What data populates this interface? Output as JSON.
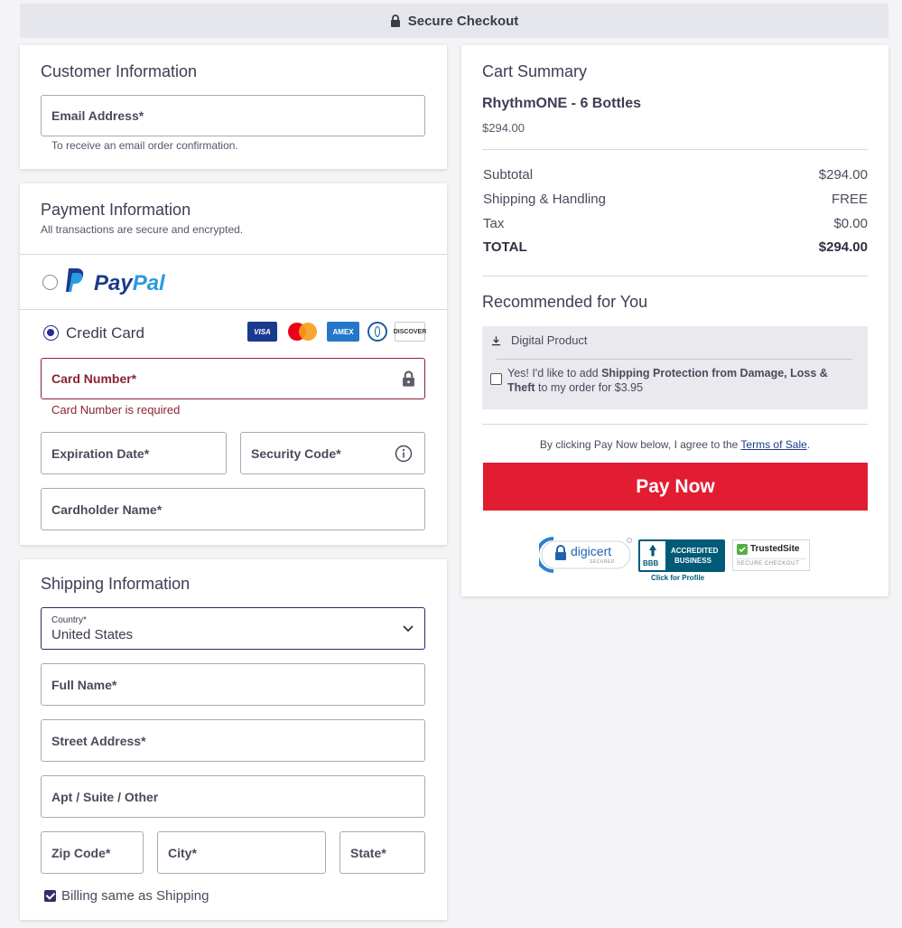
{
  "header": {
    "title": "Secure Checkout"
  },
  "customer": {
    "title": "Customer Information",
    "email_label": "Email Address*",
    "email_hint": "To receive an email order confirmation."
  },
  "payment": {
    "title": "Payment Information",
    "subtitle": "All transactions are secure and encrypted.",
    "paypal_pay": "Pay",
    "paypal_pal": "Pal",
    "credit_label": "Credit Card",
    "card_brands": [
      "VISA",
      "Mastercard",
      "AMEX",
      "Diners Club",
      "DISCOVER"
    ],
    "card_number_label": "Card Number*",
    "card_number_error": "Card Number is required",
    "expiration_label": "Expiration Date*",
    "security_label": "Security Code*",
    "cardholder_label": "Cardholder Name*"
  },
  "shipping": {
    "title": "Shipping Information",
    "country_label": "Country*",
    "country_value": "United States",
    "full_name_label": "Full Name*",
    "street_label": "Street Address*",
    "apt_label": "Apt / Suite / Other",
    "zip_label": "Zip Code*",
    "city_label": "City*",
    "state_label": "State*",
    "billing_same": "Billing same as Shipping"
  },
  "cart": {
    "title": "Cart Summary",
    "product_name": "RhythmONE - 6 Bottles",
    "product_price": "$294.00",
    "rows": [
      {
        "label": "Subtotal",
        "value": "$294.00"
      },
      {
        "label": "Shipping & Handling",
        "value": "FREE"
      },
      {
        "label": "Tax",
        "value": "$0.00"
      }
    ],
    "total_label": "TOTAL",
    "total_value": "$294.00"
  },
  "recommended": {
    "title": "Recommended for You",
    "digital_label": "Digital Product",
    "offer_pre": "Yes! I'd like to add ",
    "offer_bold1": "Shipping Protection from Damage, Loss &",
    "offer_bold2": "Theft",
    "offer_post": " to my order for $3.95"
  },
  "agreement": {
    "pre": "By clicking Pay Now below, I agree to the ",
    "link": "Terms of Sale",
    "post": "."
  },
  "pay_button": "Pay Now",
  "badges": {
    "digicert": "digicert",
    "digicert_sub": "SECURED",
    "bbb_line1": "ACCREDITED",
    "bbb_line2": "BUSINESS",
    "bbb_logo": "BBB",
    "bbb_caption": "Click for Profile",
    "trusted_name": "TrustedSite",
    "trusted_sub": "SECURE CHECKOUT"
  },
  "colors": {
    "accent": "#e21d31",
    "error": "#8a2333",
    "paypal_dark": "#1b3a8c",
    "paypal_light": "#2a9be0",
    "focus": "#2b2a6e"
  }
}
